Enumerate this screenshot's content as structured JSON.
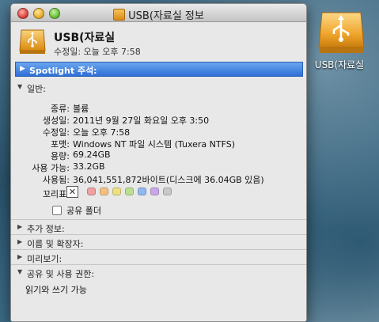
{
  "window": {
    "title": "USB(자료실 정보"
  },
  "header": {
    "name": "USB(자료실",
    "modified": "수정일:  오늘 오후 7:58"
  },
  "spotlight": {
    "label": "Spotlight 주석:"
  },
  "general": {
    "label": "일반:",
    "rows": [
      {
        "key": "종류:",
        "value": "볼륨"
      },
      {
        "key": "생성일:",
        "value": "2011년 9월 27일 화요일 오후 3:50"
      },
      {
        "key": "수정일:",
        "value": "오늘 오후 7:58"
      },
      {
        "key": "포맷:",
        "value": "Windows NT 파일 시스템 (Tuxera NTFS)"
      },
      {
        "key": "용량:",
        "value": "69.24GB"
      },
      {
        "key": "사용 가능:",
        "value": "33.2GB"
      },
      {
        "key": "사용됨:",
        "value": "36,041,551,872바이트(디스크에 36.04GB 있음)"
      }
    ],
    "tags_label": "꼬리표:",
    "tag_none": "✕",
    "tag_colors": [
      "#f0a0a0",
      "#f2c080",
      "#eee080",
      "#b8e090",
      "#90b8f0",
      "#c8a8e8",
      "#c8c8c8"
    ],
    "shared_folder": "공유 폴더"
  },
  "sections": {
    "more_info": "추가 정보:",
    "name_ext": "이름 및 확장자:",
    "preview": "미리보기:",
    "sharing": "공유 및 사용 권한:",
    "permission": "읽기와 쓰기 가능"
  },
  "desktop": {
    "icon_label": "USB(자료실"
  }
}
